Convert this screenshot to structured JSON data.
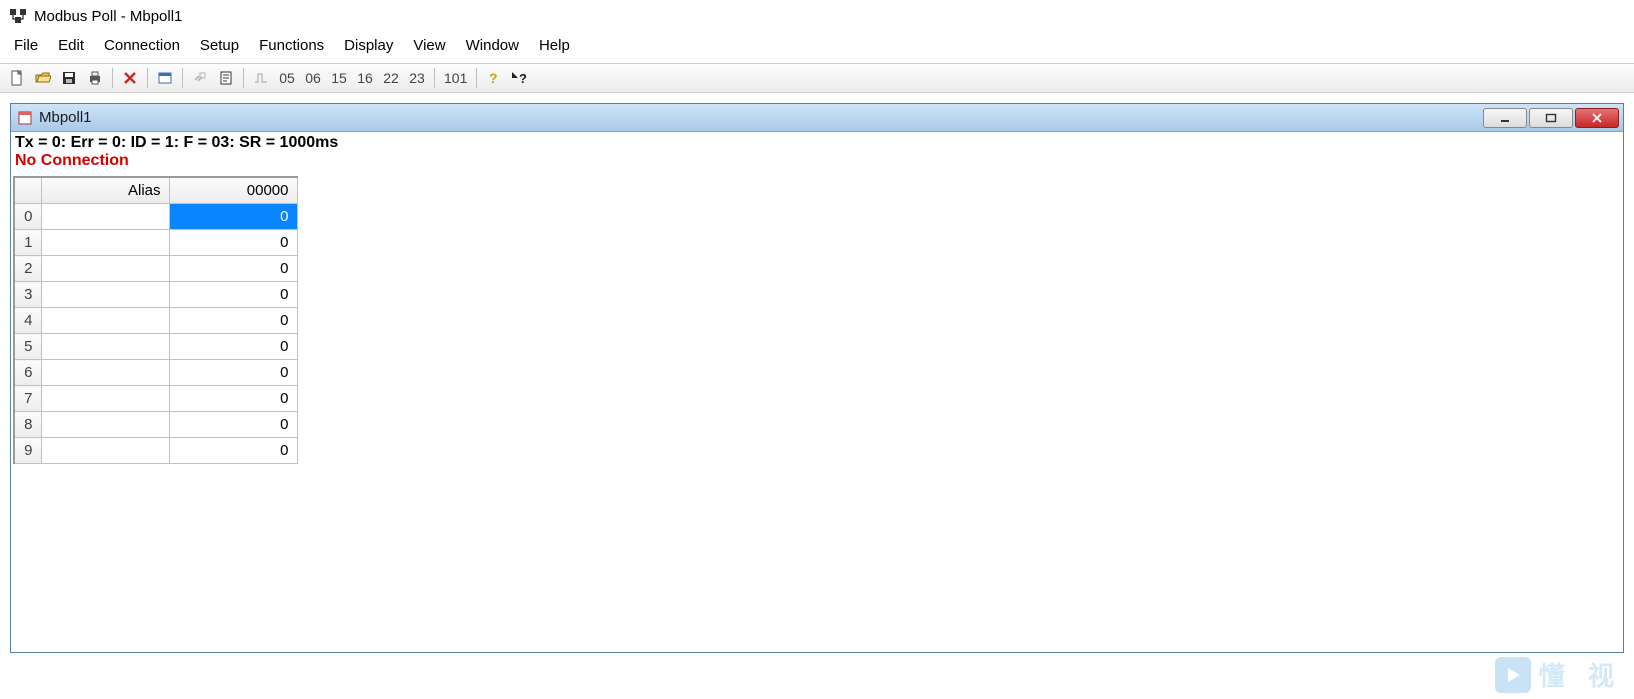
{
  "app": {
    "title": "Modbus Poll - Mbpoll1"
  },
  "menu": {
    "items": [
      "File",
      "Edit",
      "Connection",
      "Setup",
      "Functions",
      "Display",
      "View",
      "Window",
      "Help"
    ]
  },
  "toolbar_fncodes": [
    "05",
    "06",
    "15",
    "16",
    "22",
    "23"
  ],
  "toolbar_101": "101",
  "doc": {
    "title": "Mbpoll1",
    "status_line": "Tx = 0: Err = 0: ID = 1: F = 03: SR = 1000ms",
    "no_connection": "No Connection",
    "columns": {
      "alias": "Alias",
      "value": "00000"
    },
    "rows": [
      {
        "idx": "0",
        "alias": "",
        "value": "0",
        "selected": true
      },
      {
        "idx": "1",
        "alias": "",
        "value": "0",
        "selected": false
      },
      {
        "idx": "2",
        "alias": "",
        "value": "0",
        "selected": false
      },
      {
        "idx": "3",
        "alias": "",
        "value": "0",
        "selected": false
      },
      {
        "idx": "4",
        "alias": "",
        "value": "0",
        "selected": false
      },
      {
        "idx": "5",
        "alias": "",
        "value": "0",
        "selected": false
      },
      {
        "idx": "6",
        "alias": "",
        "value": "0",
        "selected": false
      },
      {
        "idx": "7",
        "alias": "",
        "value": "0",
        "selected": false
      },
      {
        "idx": "8",
        "alias": "",
        "value": "0",
        "selected": false
      },
      {
        "idx": "9",
        "alias": "",
        "value": "0",
        "selected": false
      }
    ]
  },
  "watermark": {
    "text": "懂 视"
  }
}
